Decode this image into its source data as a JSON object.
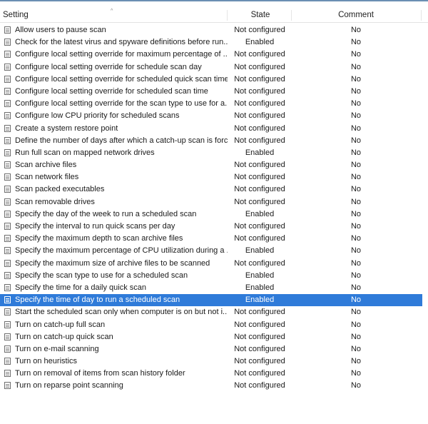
{
  "columns": {
    "setting": "Setting",
    "state": "State",
    "comment": "Comment"
  },
  "sort_indicator": "^",
  "selected_index": 22,
  "colors": {
    "selection": "#2f7bd9",
    "header_line": "#6b8fb3"
  },
  "rows": [
    {
      "name": "Allow users to pause scan",
      "state": "Not configured",
      "comment": "No"
    },
    {
      "name": "Check for the latest virus and spyware definitions before run...",
      "state": "Enabled",
      "comment": "No"
    },
    {
      "name": "Configure local setting override for maximum percentage of ...",
      "state": "Not configured",
      "comment": "No"
    },
    {
      "name": "Configure local setting override for schedule scan day",
      "state": "Not configured",
      "comment": "No"
    },
    {
      "name": "Configure local setting override for scheduled quick scan time",
      "state": "Not configured",
      "comment": "No"
    },
    {
      "name": "Configure local setting override for scheduled scan time",
      "state": "Not configured",
      "comment": "No"
    },
    {
      "name": "Configure local setting override for the scan type to use for a...",
      "state": "Not configured",
      "comment": "No"
    },
    {
      "name": "Configure low CPU priority for scheduled scans",
      "state": "Not configured",
      "comment": "No"
    },
    {
      "name": "Create a system restore point",
      "state": "Not configured",
      "comment": "No"
    },
    {
      "name": "Define the number of days after which a catch-up scan is forc...",
      "state": "Not configured",
      "comment": "No"
    },
    {
      "name": "Run full scan on mapped network drives",
      "state": "Enabled",
      "comment": "No"
    },
    {
      "name": "Scan archive files",
      "state": "Not configured",
      "comment": "No"
    },
    {
      "name": "Scan network files",
      "state": "Not configured",
      "comment": "No"
    },
    {
      "name": "Scan packed executables",
      "state": "Not configured",
      "comment": "No"
    },
    {
      "name": "Scan removable drives",
      "state": "Not configured",
      "comment": "No"
    },
    {
      "name": "Specify the day of the week to run a scheduled scan",
      "state": "Enabled",
      "comment": "No"
    },
    {
      "name": "Specify the interval to run quick scans per day",
      "state": "Not configured",
      "comment": "No"
    },
    {
      "name": "Specify the maximum depth to scan archive files",
      "state": "Not configured",
      "comment": "No"
    },
    {
      "name": "Specify the maximum percentage of CPU utilization during a ...",
      "state": "Enabled",
      "comment": "No"
    },
    {
      "name": "Specify the maximum size of archive files to be scanned",
      "state": "Not configured",
      "comment": "No"
    },
    {
      "name": "Specify the scan type to use for a scheduled scan",
      "state": "Enabled",
      "comment": "No"
    },
    {
      "name": "Specify the time for a daily quick scan",
      "state": "Enabled",
      "comment": "No"
    },
    {
      "name": "Specify the time of day to run a scheduled scan",
      "state": "Enabled",
      "comment": "No"
    },
    {
      "name": "Start the scheduled scan only when computer is on but not i...",
      "state": "Not configured",
      "comment": "No"
    },
    {
      "name": "Turn on catch-up full scan",
      "state": "Not configured",
      "comment": "No"
    },
    {
      "name": "Turn on catch-up quick scan",
      "state": "Not configured",
      "comment": "No"
    },
    {
      "name": "Turn on e-mail scanning",
      "state": "Not configured",
      "comment": "No"
    },
    {
      "name": "Turn on heuristics",
      "state": "Not configured",
      "comment": "No"
    },
    {
      "name": "Turn on removal of items from scan history folder",
      "state": "Not configured",
      "comment": "No"
    },
    {
      "name": "Turn on reparse point scanning",
      "state": "Not configured",
      "comment": "No"
    }
  ]
}
